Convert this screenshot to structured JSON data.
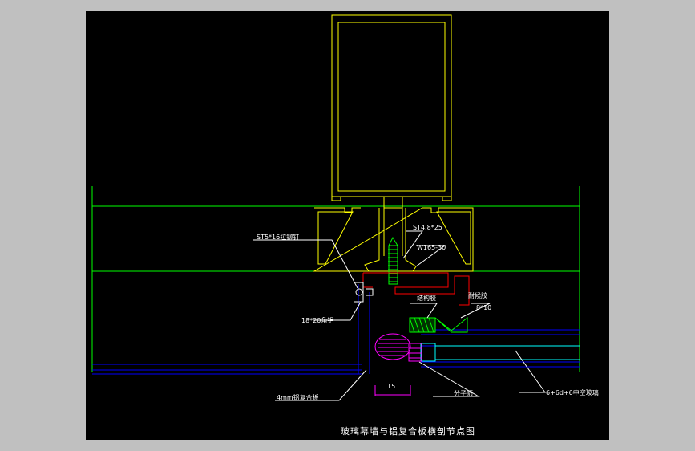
{
  "colors": {
    "frame": "#c0c0c0",
    "background": "#000000",
    "profile": "#ffff00",
    "glass_lines": "#0000ff",
    "panel_lines": "#00ffff",
    "leader": "#ff0000",
    "dimension": "#ff00ff",
    "text": "#ffffff",
    "axis": "#00ff00"
  },
  "labels": {
    "rivet": "ST5*16拉铆钉",
    "screw": "ST4.8*25",
    "washer": "W165-30",
    "angle_alu": "18*20角铝",
    "structural_sealant": "结构胶",
    "weather_sealant": "耐候胶",
    "foam_rod": "8*10",
    "composite_panel": "4mm铝复合板",
    "spacer": "分子筛",
    "glass": "6+6d+6中空玻璃",
    "dimension_15": "15"
  },
  "title": "玻璃幕墙与铝复合板横剖节点图"
}
